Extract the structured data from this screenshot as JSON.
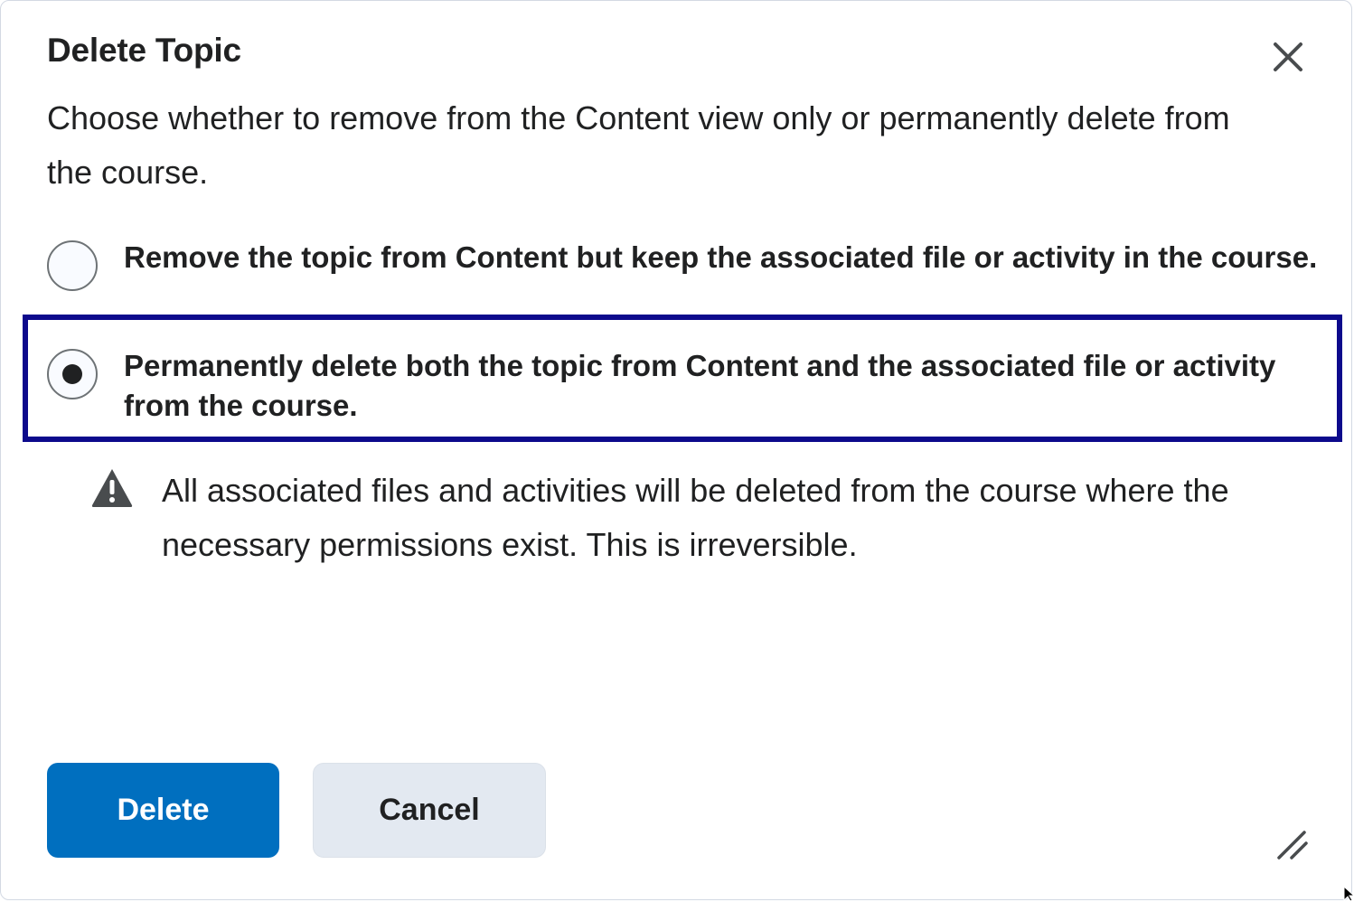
{
  "dialog": {
    "title": "Delete Topic",
    "description": "Choose whether to remove from the Content view only or permanently delete from the course.",
    "close_icon": "close-icon",
    "options": [
      {
        "label": "Remove the topic from Content but keep the associated file or activity in the course.",
        "selected": false
      },
      {
        "label": "Permanently delete both the topic from Content and the associated file or activity from the course.",
        "selected": true
      }
    ],
    "warning": {
      "icon": "warning-icon",
      "text": "All associated files and activities will be deleted from the course where the necessary permissions exist. This is irreversible."
    },
    "buttons": {
      "delete_label": "Delete",
      "cancel_label": "Cancel"
    },
    "resize_icon": "resize-grip-icon"
  },
  "colors": {
    "primary": "#006fbf",
    "secondary_button": "#e3e9f1",
    "focus_ring": "#0d0a8c",
    "text": "#202122"
  }
}
